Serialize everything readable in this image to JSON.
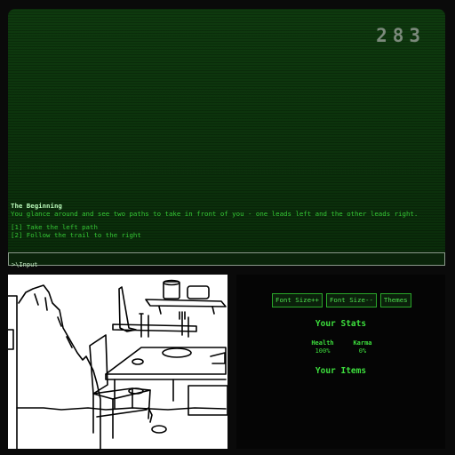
{
  "game": {
    "score": "283",
    "story_title": "The Beginning",
    "story_text": "You glance around and see two paths to take in front of you - one leads left and the other leads right.",
    "choices": [
      "[1] Take the left path",
      "[2] Follow the trail to the right"
    ],
    "input_placeholder": ">\\Input"
  },
  "controls": {
    "font_up": "Font Size++",
    "font_down": "Font Size--",
    "themes": "Themes"
  },
  "stats": {
    "title": "Your Stats",
    "health_label": "Health",
    "health_value": "100%",
    "karma_label": "Karma",
    "karma_value": "0%"
  },
  "items": {
    "title": "Your Items"
  },
  "colors": {
    "terminal_bg": "#0e3a0e",
    "terminal_text": "#35c735",
    "accent": "#3ddf3d"
  }
}
